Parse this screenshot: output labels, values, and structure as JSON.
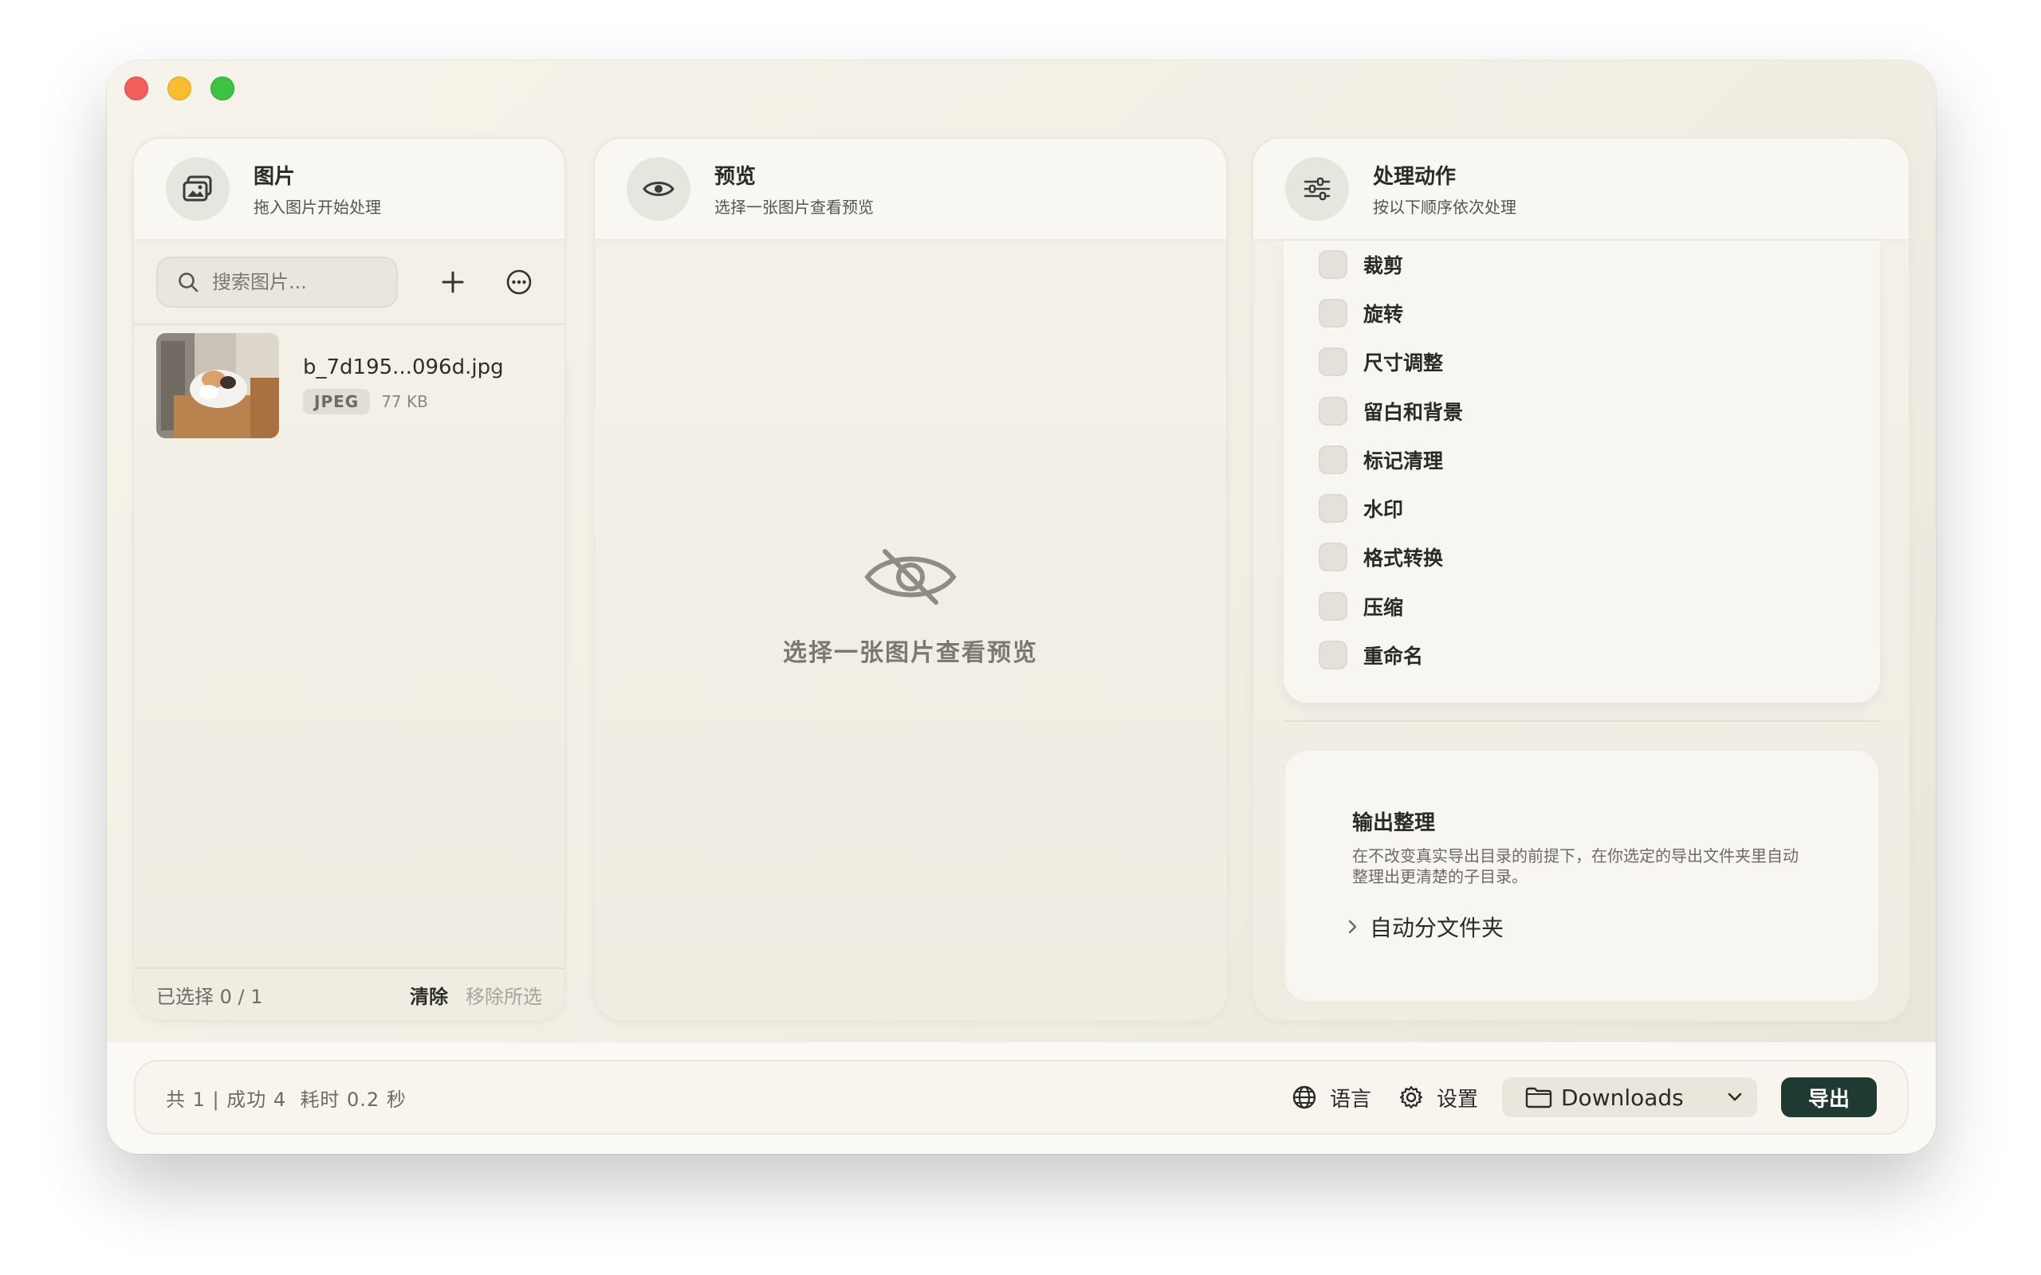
{
  "images_panel": {
    "title": "图片",
    "subtitle": "拖入图片开始处理",
    "search_placeholder": "搜索图片...",
    "files": [
      {
        "name": "b_7d195...096d.jpg",
        "format": "JPEG",
        "size": "77 KB"
      }
    ],
    "selection": "已选择 0 / 1",
    "clear_label": "清除",
    "remove_selected_label": "移除所选"
  },
  "preview_panel": {
    "title": "预览",
    "subtitle": "选择一张图片查看预览",
    "empty_text": "选择一张图片查看预览"
  },
  "actions_panel": {
    "title": "处理动作",
    "subtitle": "按以下顺序依次处理",
    "actions": [
      "裁剪",
      "旋转",
      "尺寸调整",
      "留白和背景",
      "标记清理",
      "水印",
      "格式转换",
      "压缩",
      "重命名"
    ],
    "output": {
      "title": "输出整理",
      "description": "在不改变真实导出目录的前提下，在你选定的导出文件夹里自动整理出更清楚的子目录。",
      "auto_folder_label": "自动分文件夹"
    }
  },
  "bottom_bar": {
    "stats": "共 1 | 成功 4  耗时 0.2 秒",
    "language_label": "语言",
    "settings_label": "设置",
    "directory": "Downloads",
    "export_label": "导出"
  },
  "colors": {
    "accent": "#1f3a30",
    "background": "#f4f1e9",
    "close": "#f25f58",
    "minimize": "#f9bd2e",
    "maximize": "#3ec244"
  }
}
